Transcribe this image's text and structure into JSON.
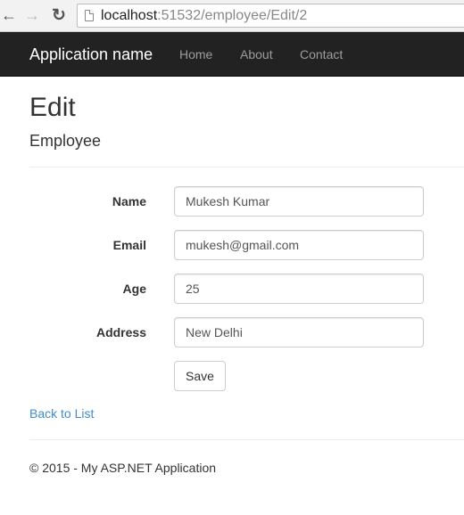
{
  "browser": {
    "url_host": "localhost",
    "url_path": ":51532/employee/Edit/2",
    "back_icon": "←",
    "forward_icon": "→",
    "reload_icon": "↻"
  },
  "navbar": {
    "brand": "Application name",
    "links": [
      "Home",
      "About",
      "Contact"
    ]
  },
  "page": {
    "title": "Edit",
    "subtitle": "Employee"
  },
  "form": {
    "fields": [
      {
        "label": "Name",
        "value": "Mukesh Kumar"
      },
      {
        "label": "Email",
        "value": "mukesh@gmail.com"
      },
      {
        "label": "Age",
        "value": "25"
      },
      {
        "label": "Address",
        "value": "New Delhi"
      }
    ],
    "save_label": "Save"
  },
  "back_link": "Back to List",
  "footer": "© 2015 - My ASP.NET Application",
  "colors": {
    "navbar_bg": "#222222",
    "link": "#428bca"
  }
}
